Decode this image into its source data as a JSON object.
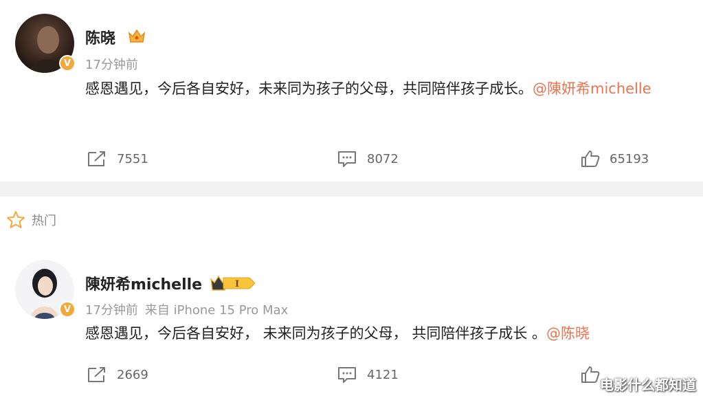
{
  "posts": [
    {
      "author": "陈晓",
      "verified_badge": "V",
      "time": "17分钟前",
      "source": "",
      "text": "感恩遇见，今后各自安好，未来同为孩子的父母，共同陪伴孩子成长。",
      "mention": "@陳妍希michelle",
      "reposts": "7551",
      "comments": "8072",
      "likes": "65193"
    },
    {
      "author": "陳妍希michelle",
      "verified_badge": "V",
      "member_level": "I",
      "time": "17分钟前",
      "source": "来自 iPhone 15 Pro Max",
      "text": "感恩遇见，今后各自安好， 未来同为孩子的父母， 共同陪伴孩子成长 。",
      "mention": "@陈晓",
      "reposts": "2669",
      "comments": "4121",
      "likes": ""
    }
  ],
  "section": {
    "hot_label": "热门"
  },
  "watermark": "电影什么都知道",
  "colors": {
    "accent": "#eb7350",
    "meta": "#999999",
    "badge": "#f2a93b",
    "divider": "#f2f2f2"
  },
  "icons": [
    "crown-icon",
    "verified-icon",
    "repost-icon",
    "comment-icon",
    "like-icon",
    "star-icon"
  ]
}
